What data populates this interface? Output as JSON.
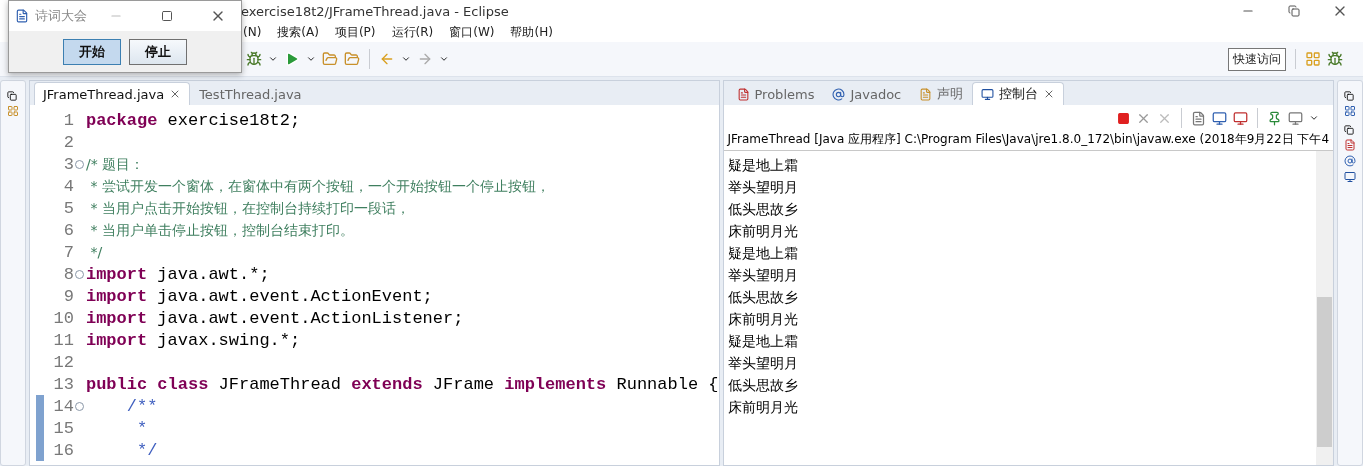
{
  "window": {
    "title": "exercise18t2/JFrameThread.java - Eclipse"
  },
  "menu": [
    "(N)",
    "搜索(A)",
    "项目(P)",
    "运行(R)",
    "窗口(W)",
    "帮助(H)"
  ],
  "quick_access": "快速访问",
  "dialog": {
    "title": "诗词大会",
    "buttons": [
      {
        "label": "开始",
        "focused": true
      },
      {
        "label": "停止",
        "focused": false
      }
    ]
  },
  "editor": {
    "tabs": [
      {
        "label": "JFrameThread.java",
        "selected": true
      },
      {
        "label": "TestThread.java",
        "selected": false
      }
    ],
    "lines": [
      {
        "n": "1",
        "fold": false,
        "changed": false,
        "tokens": [
          {
            "kind": "keyword",
            "text": "package"
          },
          {
            "kind": "plain",
            "text": " exercise18t2;"
          }
        ]
      },
      {
        "n": "2",
        "fold": false,
        "changed": false
      },
      {
        "n": "3",
        "fold": true,
        "changed": false,
        "tokens": [
          {
            "kind": "comment",
            "text": "/* 题目："
          }
        ]
      },
      {
        "n": "4",
        "fold": false,
        "changed": false,
        "tokens": [
          {
            "kind": "comment",
            "text": " * 尝试开发一个窗体，在窗体中有两个按钮，一个开始按钮一个停止按钮，"
          }
        ]
      },
      {
        "n": "5",
        "fold": false,
        "changed": false,
        "tokens": [
          {
            "kind": "comment",
            "text": " * 当用户点击开始按钮，在控制台持续打印一段话，"
          }
        ]
      },
      {
        "n": "6",
        "fold": false,
        "changed": false,
        "tokens": [
          {
            "kind": "comment",
            "text": " * 当用户单击停止按钮，控制台结束打印。"
          }
        ]
      },
      {
        "n": "7",
        "fold": false,
        "changed": false,
        "tokens": [
          {
            "kind": "comment",
            "text": " */"
          }
        ]
      },
      {
        "n": "8",
        "fold": true,
        "changed": false,
        "tokens": [
          {
            "kind": "keyword",
            "text": "import"
          },
          {
            "kind": "plain",
            "text": " java.awt.*;"
          }
        ]
      },
      {
        "n": "9",
        "fold": false,
        "changed": false,
        "tokens": [
          {
            "kind": "keyword",
            "text": "import"
          },
          {
            "kind": "plain",
            "text": " java.awt.event.ActionEvent;"
          }
        ]
      },
      {
        "n": "10",
        "fold": false,
        "changed": false,
        "tokens": [
          {
            "kind": "keyword",
            "text": "import"
          },
          {
            "kind": "plain",
            "text": " java.awt.event.ActionListener;"
          }
        ]
      },
      {
        "n": "11",
        "fold": false,
        "changed": false,
        "tokens": [
          {
            "kind": "keyword",
            "text": "import"
          },
          {
            "kind": "plain",
            "text": " javax.swing.*;"
          }
        ]
      },
      {
        "n": "12",
        "fold": false,
        "changed": false
      },
      {
        "n": "13",
        "fold": false,
        "changed": false,
        "tokens": [
          {
            "kind": "keyword",
            "text": "public class"
          },
          {
            "kind": "plain",
            "text": " JFrameThread "
          },
          {
            "kind": "keyword",
            "text": "extends"
          },
          {
            "kind": "plain",
            "text": " JFrame "
          },
          {
            "kind": "keyword",
            "text": "implements"
          },
          {
            "kind": "plain",
            "text": " Runnable {"
          }
        ]
      },
      {
        "n": "14",
        "fold": true,
        "changed": true,
        "tokens": [
          {
            "kind": "javadoc",
            "text": "    /**"
          }
        ]
      },
      {
        "n": "15",
        "fold": false,
        "changed": true,
        "tokens": [
          {
            "kind": "javadoc",
            "text": "     *"
          }
        ]
      },
      {
        "n": "16",
        "fold": false,
        "changed": true,
        "tokens": [
          {
            "kind": "javadoc",
            "text": "     */"
          }
        ]
      }
    ]
  },
  "console": {
    "tabs": [
      {
        "label": "Problems",
        "selected": false
      },
      {
        "label": "Javadoc",
        "selected": false
      },
      {
        "label": "声明",
        "selected": false
      },
      {
        "label": "控制台",
        "selected": true
      }
    ],
    "header": "JFrameThread [Java 应用程序] C:\\Program Files\\Java\\jre1.8.0_172\\bin\\javaw.exe  (2018年9月22日 下午4",
    "output": [
      "疑是地上霜",
      "举头望明月",
      "低头思故乡",
      "床前明月光",
      "疑是地上霜",
      "举头望明月",
      "低头思故乡",
      "床前明月光",
      "疑是地上霜",
      "举头望明月",
      "低头思故乡",
      "床前明月光"
    ]
  }
}
